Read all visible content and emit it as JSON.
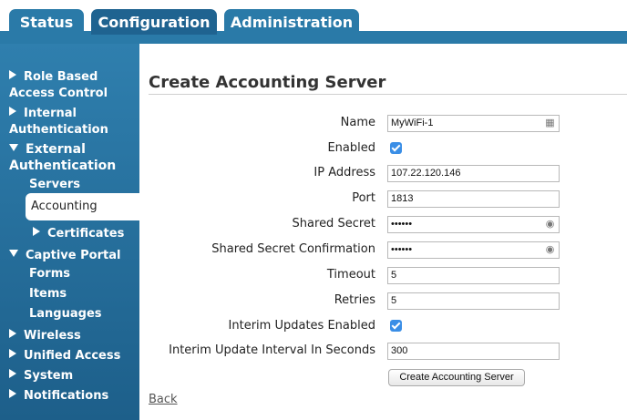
{
  "tabs": [
    {
      "label": "Status",
      "active": false
    },
    {
      "label": "Configuration",
      "active": true
    },
    {
      "label": "Administration",
      "active": false
    }
  ],
  "sidebar": {
    "items": [
      {
        "label": "Role Based Access Control",
        "line1": "Role Based",
        "line2": "Access Control",
        "expanded": false
      },
      {
        "label": "Internal Authentication",
        "line1": "Internal",
        "line2": "Authentication",
        "expanded": false
      },
      {
        "label": "External Authentication",
        "line1": "External",
        "line2": "Authentication",
        "expanded": true
      },
      {
        "label": "Servers"
      },
      {
        "label": "Accounting",
        "selected": true
      },
      {
        "label": "Certificates",
        "expanded": false
      },
      {
        "label": "Captive Portal",
        "expanded": true
      },
      {
        "label": "Forms"
      },
      {
        "label": "Items"
      },
      {
        "label": "Languages"
      },
      {
        "label": "Wireless",
        "expanded": false
      },
      {
        "label": "Unified Access",
        "expanded": false
      },
      {
        "label": "System",
        "expanded": false
      },
      {
        "label": "Notifications",
        "expanded": false
      }
    ]
  },
  "page": {
    "title": "Create Accounting Server"
  },
  "form": {
    "name_label": "Name",
    "name_value": "MyWiFi-1",
    "enabled_label": "Enabled",
    "enabled_checked": true,
    "ip_label": "IP Address",
    "ip_value": "107.22.120.146",
    "port_label": "Port",
    "port_value": "1813",
    "secret_label": "Shared Secret",
    "secret_value": "••••••",
    "secret_confirm_label": "Shared Secret Confirmation",
    "secret_confirm_value": "••••••",
    "timeout_label": "Timeout",
    "timeout_value": "5",
    "retries_label": "Retries",
    "retries_value": "5",
    "interim_enabled_label": "Interim Updates Enabled",
    "interim_enabled_checked": true,
    "interim_interval_label": "Interim Update Interval In Seconds",
    "interim_interval_value": "300",
    "submit_label": "Create Accounting Server"
  },
  "footer": {
    "back_label": "Back"
  },
  "icons": {
    "name_field": "contact-card-icon",
    "secret_field": "password-reveal-icon"
  },
  "colors": {
    "tab_bg": "#2a7aa8",
    "tab_active_bg": "#1f6390",
    "sidebar_top": "#2f7fae",
    "sidebar_bottom": "#1d5f8a",
    "checkbox": "#3a8ee6"
  }
}
